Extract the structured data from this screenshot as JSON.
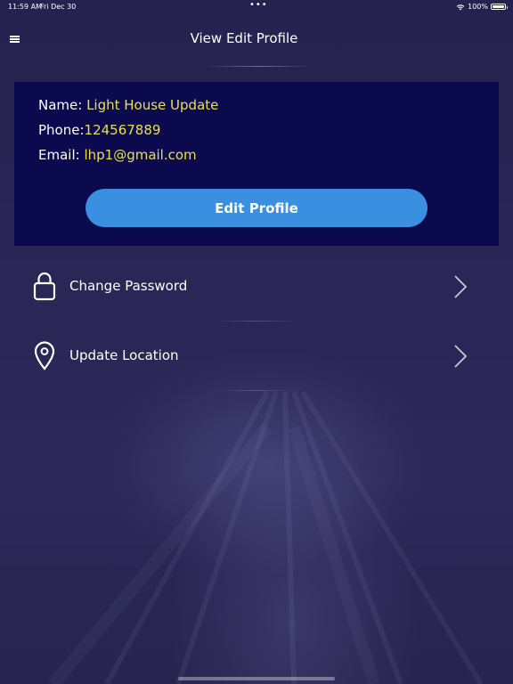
{
  "status_bar": {
    "time": "11:59 AM",
    "date": "Fri Dec 30",
    "dots": "•••",
    "battery": "100%"
  },
  "header": {
    "title": "View Edit Profile"
  },
  "profile": {
    "name_label": "Name: ",
    "name_value": "Light House Update",
    "phone_label": "Phone:",
    "phone_value": "124567889",
    "email_label": "Email: ",
    "email_value": "lhp1@gmail.com",
    "edit_button_label": "Edit Profile"
  },
  "options": [
    {
      "label": "Change Password",
      "icon": "lock-icon"
    },
    {
      "label": "Update Location",
      "icon": "location-pin-icon"
    }
  ],
  "colors": {
    "background": "#2a2656",
    "card": "#0b0a4f",
    "accent_text": "#e8e04a",
    "button": "#3a8fe0"
  }
}
